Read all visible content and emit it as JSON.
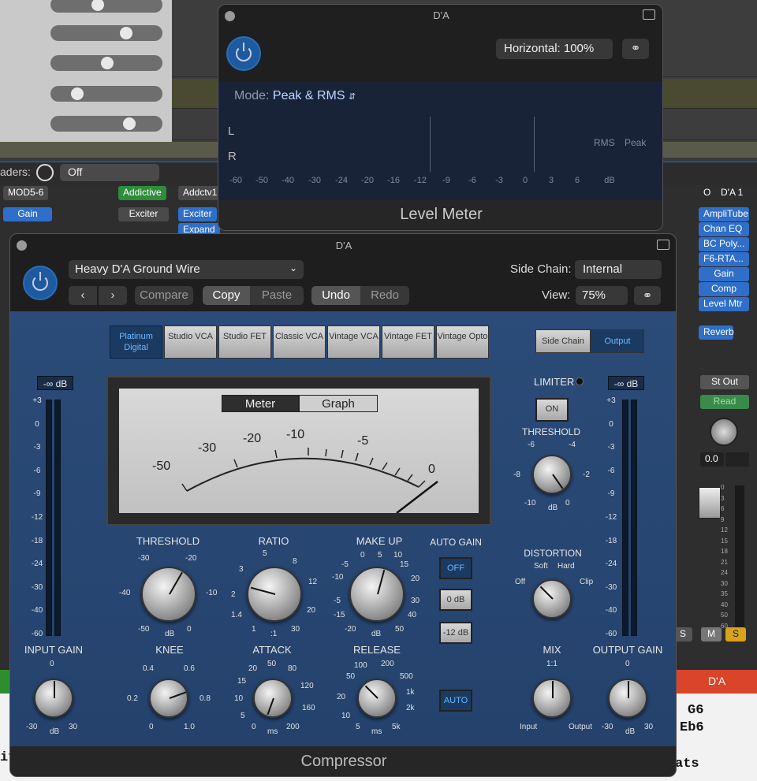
{
  "background": {
    "sliders_visible": 5,
    "side_chain_label": "aders:",
    "side_chain_value": "Off",
    "mixer_chips": [
      {
        "text": "MOD5-6",
        "style": "grey"
      },
      {
        "text": "Gain",
        "style": "blue"
      },
      {
        "text": "Addictive",
        "style": "green"
      },
      {
        "text": "Addctv1",
        "style": "grey"
      },
      {
        "text": "Exciter",
        "style": "grey"
      },
      {
        "text": "Exciter",
        "style": "blue"
      },
      {
        "text": "Expand",
        "style": "blue"
      }
    ],
    "right_strip": {
      "io": "O",
      "name": "D'A 1",
      "plugins": [
        "AmpliTube",
        "Chan EQ",
        "BC Poly...",
        "F6-RTA...",
        "Gain",
        "Comp",
        "Level Mtr"
      ],
      "send": "Reverb",
      "output": "St Out",
      "automation": "Read",
      "value": "0.0",
      "fader_scale": [
        "0",
        "3",
        "6",
        "9",
        "12",
        "15",
        "18",
        "21",
        "24",
        "30",
        "35",
        "40",
        "50",
        "60"
      ],
      "mute": "M",
      "solo": "S",
      "solo_left": "S",
      "track_name": "D'A"
    },
    "score_text": [
      "G6",
      "Eb6",
      "ats",
      "if"
    ]
  },
  "level_meter": {
    "window_title": "D'A",
    "horizontal_label": "Horizontal: 100%",
    "mode_label": "Mode:",
    "mode_value": "Peak & RMS",
    "channel_L": "L",
    "channel_R": "R",
    "rms_label": "RMS",
    "peak_label": "Peak",
    "scale": [
      "-60",
      "-50",
      "-40",
      "-30",
      "-24",
      "-20",
      "-16",
      "-12",
      "-9",
      "-6",
      "-3",
      "0",
      "3",
      "6",
      "dB"
    ],
    "plugin_name": "Level Meter"
  },
  "compressor": {
    "window_title": "D'A",
    "preset": "Heavy D'A Ground Wire",
    "side_chain_label": "Side Chain:",
    "side_chain_value": "Internal",
    "buttons": {
      "compare": "Compare",
      "copy": "Copy",
      "paste": "Paste",
      "undo": "Undo",
      "redo": "Redo"
    },
    "view_label": "View:",
    "view_value": "75%",
    "models": [
      "Platinum Digital",
      "Studio VCA",
      "Studio FET",
      "Classic VCA",
      "Vintage VCA",
      "Vintage FET",
      "Vintage Opto"
    ],
    "selected_model": "Platinum Digital",
    "side_chain_btn": "Side Chain",
    "output_btn": "Output",
    "vu": {
      "meter_tab": "Meter",
      "graph_tab": "Graph",
      "scale": [
        "-50",
        "-30",
        "-20",
        "-10",
        "-5",
        "0"
      ]
    },
    "input_db": "-∞ dB",
    "output_db": "-∞ dB",
    "meter_scale": [
      "+3",
      "0",
      "-3",
      "-6",
      "-9",
      "-12",
      "-18",
      "-24",
      "-30",
      "-40",
      "-60"
    ],
    "limiter_label": "LIMITER",
    "limiter_btn": "ON",
    "knobs": {
      "threshold": {
        "label": "THRESHOLD",
        "ticks": [
          "-30",
          "-20",
          "-40",
          "-10",
          "-50",
          "0"
        ],
        "unit": "dB"
      },
      "ratio": {
        "label": "RATIO",
        "ticks": [
          "5",
          "8",
          "3",
          "12",
          "2",
          "20",
          "1.4",
          "30",
          "1"
        ],
        "unit": ":1"
      },
      "makeup": {
        "label": "MAKE UP",
        "ticks": [
          "0",
          "5",
          "10",
          "-5",
          "15",
          "-10",
          "20",
          "-5",
          "30",
          "-15",
          "40",
          "-20",
          "50"
        ],
        "unit": "dB"
      },
      "knee": {
        "label": "KNEE",
        "ticks": [
          "0.4",
          "0.6",
          "0.2",
          "0.8",
          "0",
          "1.0"
        ]
      },
      "attack": {
        "label": "ATTACK",
        "ticks": [
          "20",
          "50",
          "80",
          "15",
          "120",
          "10",
          "160",
          "5",
          "200",
          "0"
        ],
        "unit": "ms"
      },
      "release": {
        "label": "RELEASE",
        "ticks": [
          "100",
          "200",
          "50",
          "500",
          "20",
          "1k",
          "10",
          "2k",
          "5",
          "5k"
        ],
        "unit": "ms"
      },
      "lim_threshold": {
        "label": "THRESHOLD",
        "ticks": [
          "-6",
          "-4",
          "-8",
          "-2",
          "-10",
          "0"
        ],
        "unit": "dB"
      },
      "distortion": {
        "label": "DISTORTION",
        "ticks": [
          "Soft",
          "Hard",
          "Off",
          "Clip"
        ]
      },
      "mix": {
        "label": "MIX",
        "ticks": [
          "1:1",
          "Input",
          "Output"
        ]
      },
      "input_gain": {
        "label": "INPUT GAIN",
        "ticks": [
          "0",
          "-30",
          "30"
        ],
        "unit": "dB"
      },
      "output_gain": {
        "label": "OUTPUT GAIN",
        "ticks": [
          "0",
          "-30",
          "30"
        ],
        "unit": "dB"
      }
    },
    "auto_gain_label": "AUTO GAIN",
    "auto_gain_buttons": [
      "OFF",
      "0 dB",
      "-12 dB"
    ],
    "auto_release": "AUTO",
    "plugin_name": "Compressor"
  }
}
